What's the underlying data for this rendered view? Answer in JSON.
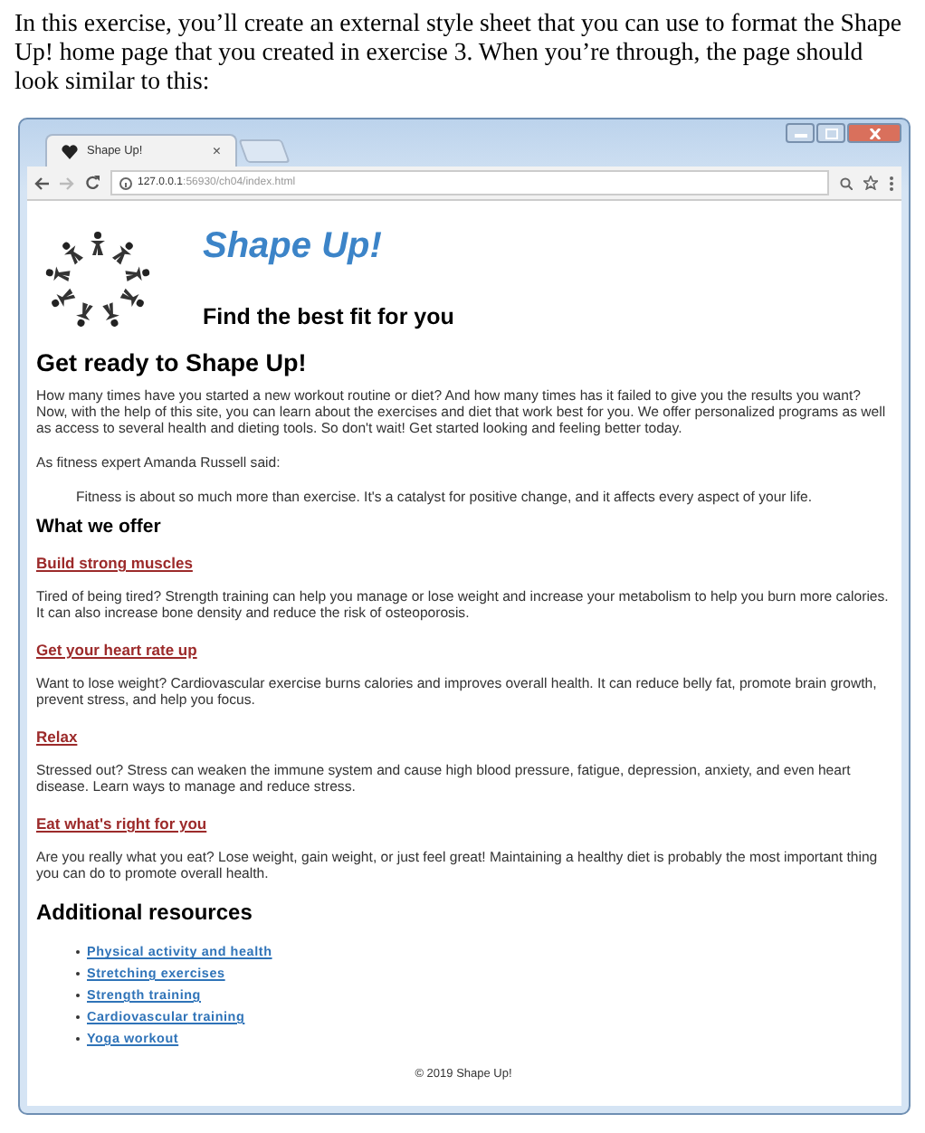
{
  "intro": "In this exercise, you’ll create an external style sheet that you can use to format the Shape Up! home page that you created in exercise 3. When you’re through, the page should look similar to this:",
  "browser": {
    "tab": {
      "title": "Shape Up!",
      "close": "×"
    },
    "address": {
      "host": "127.0.0.1",
      "path": ":56930/ch04/index.html"
    }
  },
  "page": {
    "title": "Shape Up!",
    "tagline": "Find the best fit for you",
    "blocks": [
      {
        "kind": "h2",
        "text": "Get ready to Shape Up!"
      },
      {
        "kind": "p",
        "text": "How many times have you started a new workout routine or diet? And how many times has it failed to give you the results you want? Now, with the help of this site, you can learn about the exercises and diet that work best for you. We offer personalized programs as well as access to several health and dieting tools. So don't wait! Get started looking and feeling better today."
      },
      {
        "kind": "p",
        "text": "As fitness expert Amanda Russell said:"
      },
      {
        "kind": "quote",
        "text": "Fitness is about so much more than exercise. It's a catalyst for positive change, and it affects every aspect of your life."
      },
      {
        "kind": "h3",
        "text": "What we offer"
      },
      {
        "kind": "link",
        "text": "Build strong muscles"
      },
      {
        "kind": "p",
        "text": "Tired of being tired? Strength training can help you manage or lose weight and increase your metabolism to help you burn more calories. It can also increase bone density and reduce the risk of osteoporosis."
      },
      {
        "kind": "link",
        "text": "Get your heart rate up"
      },
      {
        "kind": "p",
        "text": "Want to lose weight? Cardiovascular exercise burns calories and improves overall health. It can reduce belly fat, promote brain growth, prevent stress, and help you focus."
      },
      {
        "kind": "link",
        "text": "Relax"
      },
      {
        "kind": "p",
        "text": "Stressed out? Stress can weaken the immune system and cause high blood pressure, fatigue, depression, anxiety, and even heart disease. Learn ways to manage and reduce stress."
      },
      {
        "kind": "link",
        "text": "Eat what's right for you"
      },
      {
        "kind": "p",
        "text": "Are you really what you eat? Lose weight, gain weight, or just feel great! Maintaining a healthy diet is probably the most important thing you can do to promote overall health."
      },
      {
        "kind": "h3big",
        "text": "Additional resources"
      },
      {
        "kind": "list",
        "items": [
          "Physical activity and health",
          "Stretching exercises",
          "Strength training",
          "Cardiovascular training",
          "Yoga workout"
        ]
      },
      {
        "kind": "footer",
        "text": "© 2019 Shape Up!"
      }
    ]
  }
}
